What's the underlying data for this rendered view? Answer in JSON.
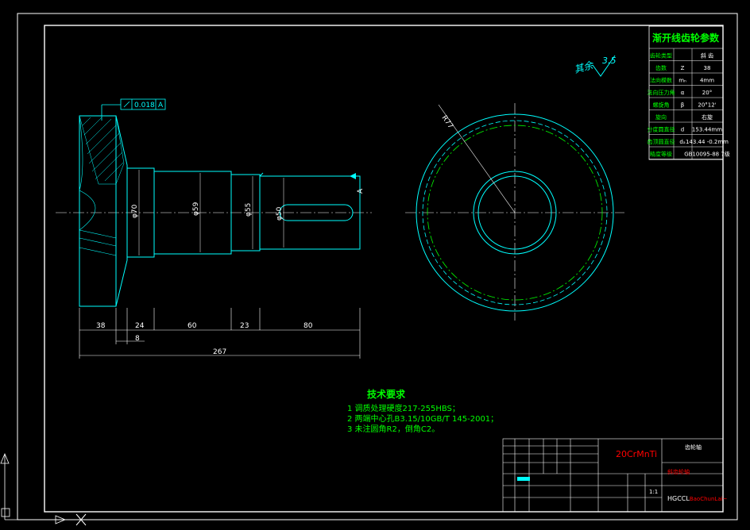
{
  "colors": {
    "background": "#000000",
    "frame": "#ffffff",
    "part": "#00ffff",
    "centerline": "#ffffff",
    "text_green": "#00ff00",
    "gear_circle": "#ffff00",
    "red": "#ff0000"
  },
  "gear_table": {
    "title": "渐开线齿轮参数",
    "rows": [
      {
        "name": "齿轮类型",
        "symbol": "",
        "value": "斜 齿"
      },
      {
        "name": "齿数",
        "symbol": "Z",
        "value": "38"
      },
      {
        "name": "法向模数",
        "symbol": "mₙ",
        "value": "4mm"
      },
      {
        "name": "法向压力角",
        "symbol": "α",
        "value": "20°"
      },
      {
        "name": "螺旋角",
        "symbol": "β",
        "value": "20°12'"
      },
      {
        "name": "旋向",
        "symbol": "",
        "value": "右旋"
      },
      {
        "name": "分度圆直径",
        "symbol": "d",
        "value": "153.44mm"
      },
      {
        "name": "齿顶圆直径",
        "symbol": "dₐ",
        "value": "143.44 -0.2mm"
      },
      {
        "name": "精度等级",
        "symbol": "",
        "value": "GB10095-88  7级"
      }
    ]
  },
  "surface_finish": {
    "label": "其余",
    "value": "3.5"
  },
  "tolerance": {
    "value": "0.018",
    "datum": "A"
  },
  "datum_label": "A",
  "dimensions": {
    "length_38": "38",
    "length_24": "24",
    "length_60": "60",
    "length_23": "23",
    "length_80": "80",
    "length_8": "8",
    "total_length": "267",
    "dia_70": "φ70",
    "dia_59": "φ59",
    "dia_55": "φ55",
    "dia_50": "φ50",
    "radius_77": "R77"
  },
  "tech_requirements": {
    "title": "技术要求",
    "items": [
      "1  调质处理硬度217-255HBS；",
      "2  两端中心孔B3.15/10GB/T 145-2001；",
      "3  未注圆角R2，倒角C2。"
    ]
  },
  "title_block": {
    "material": "20CrMnTi",
    "drawing_title": "齿轮轴",
    "school": "HGCCL",
    "school_suffix": "BaoChunLai~",
    "scale": "1:1",
    "part_name": "斜齿轮轴"
  }
}
